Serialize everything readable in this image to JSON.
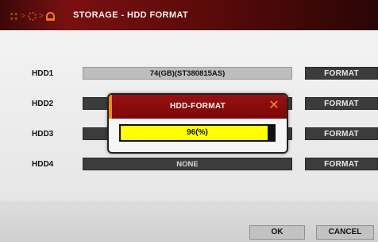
{
  "header": {
    "title": "STORAGE - HDD FORMAT",
    "breadcrumb_icons": [
      "grid-icon",
      "gear-icon",
      "storage-icon"
    ],
    "separator": ">"
  },
  "rows": [
    {
      "label": "HDD1",
      "value": "74(GB)(ST380815AS)",
      "action": "FORMAT"
    },
    {
      "label": "HDD2",
      "value": "",
      "action": "FORMAT"
    },
    {
      "label": "HDD3",
      "value": "",
      "action": "FORMAT"
    },
    {
      "label": "HDD4",
      "value": "NONE",
      "action": "FORMAT"
    }
  ],
  "buttons": {
    "ok": "OK",
    "cancel": "CANCEL"
  },
  "dialog": {
    "title": "HDD-FORMAT",
    "close_glyph": "✕",
    "progress_text": "96(%)",
    "progress_fraction": 0.96
  },
  "colors": {
    "title_bar": "#7a1010",
    "accent": "#f08a1a",
    "progress": "#ffff00"
  }
}
